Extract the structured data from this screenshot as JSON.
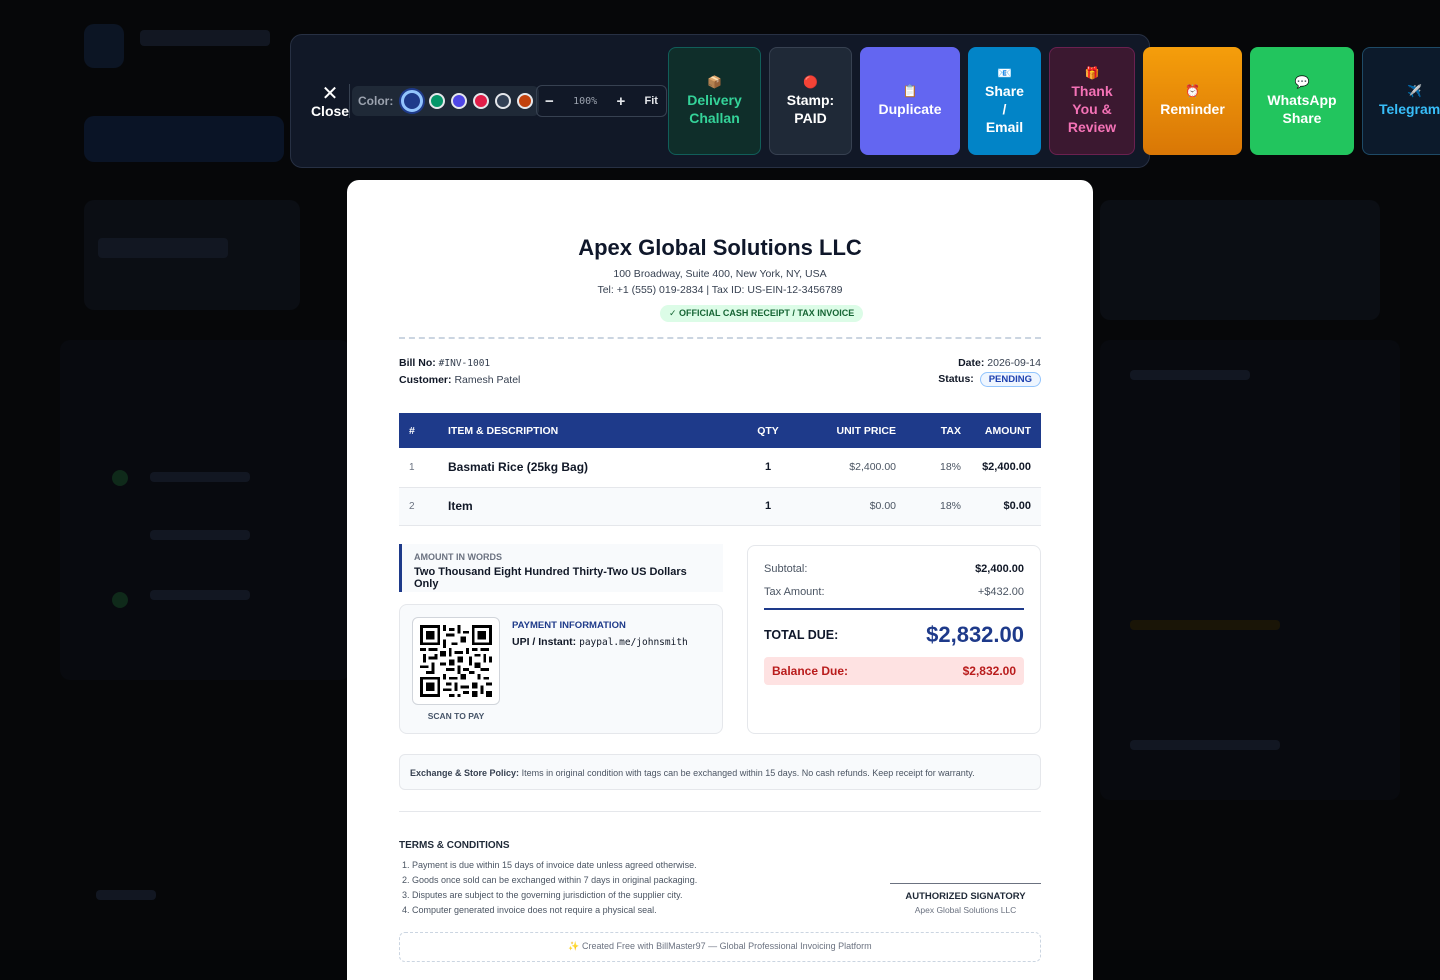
{
  "toolbar": {
    "close_icon": "✕",
    "close_label": "Close",
    "color_label": "Color:",
    "swatches": [
      "#1e3a8a",
      "#059669",
      "#4f46e5",
      "#e11d48",
      "#334155",
      "#c2410c"
    ],
    "zoom_minus": "−",
    "zoom_value": "100%",
    "zoom_plus": "+",
    "fit_label": "Fit",
    "buttons": [
      {
        "icon": "📦",
        "line1": "Delivery",
        "line2": "Challan",
        "line3": ""
      },
      {
        "icon": "🔴",
        "line1": "Stamp:",
        "line2": "PAID",
        "line3": ""
      },
      {
        "icon": "📋",
        "line1": "Duplicate",
        "line2": "",
        "line3": ""
      },
      {
        "icon": "📧",
        "line1": "Share",
        "line2": "/",
        "line3": "Email"
      },
      {
        "icon": "🎁",
        "line1": "Thank",
        "line2": "You &",
        "line3": "Review"
      },
      {
        "icon": "⏰",
        "line1": "Reminder",
        "line2": "",
        "line3": ""
      },
      {
        "icon": "💬",
        "line1": "WhatsApp",
        "line2": "Share",
        "line3": ""
      },
      {
        "icon": "✈️",
        "line1": "Telegram",
        "line2": "",
        "line3": ""
      }
    ]
  },
  "invoice": {
    "company": "Apex Global Solutions LLC",
    "address": "100 Broadway, Suite 400, New York, NY, USA",
    "contact": "Tel: +1 (555) 019-2834 | Tax ID: US-EIN-12-3456789",
    "official_badge": "✓ OFFICIAL CASH RECEIPT / TAX INVOICE",
    "bill_no_label": "Bill No:",
    "bill_no": "#INV-1001",
    "customer_label": "Customer:",
    "customer": "Ramesh Patel",
    "date_label": "Date:",
    "date": "2026-09-14",
    "status_label": "Status:",
    "status": "PENDING",
    "columns": [
      "#",
      "ITEM & DESCRIPTION",
      "QTY",
      "UNIT PRICE",
      "TAX",
      "AMOUNT"
    ],
    "items": [
      {
        "num": "1",
        "desc": "Basmati Rice (25kg Bag)",
        "qty": "1",
        "unit_price": "$2,400.00",
        "tax": "18%",
        "amount": "$2,400.00"
      },
      {
        "num": "2",
        "desc": "Item",
        "qty": "1",
        "unit_price": "$0.00",
        "tax": "18%",
        "amount": "$0.00"
      }
    ],
    "amount_words_label": "AMOUNT IN WORDS",
    "amount_words": "Two Thousand Eight Hundred Thirty-Two US Dollars Only",
    "payment_label": "PAYMENT INFORMATION",
    "payment_method": "UPI / Instant:",
    "payment_handle": "paypal.me/johnsmith",
    "scan_label": "SCAN TO PAY",
    "subtotal_label": "Subtotal:",
    "subtotal": "$2,400.00",
    "tax_label": "Tax Amount:",
    "tax_amount": "+$432.00",
    "total_label": "TOTAL DUE:",
    "total": "$2,832.00",
    "balance_label": "Balance Due:",
    "balance": "$2,832.00",
    "policy_label": "Exchange & Store Policy:",
    "policy_text": "Items in original condition with tags can be exchanged within 15 days. No cash refunds. Keep receipt for warranty.",
    "terms_title": "TERMS & CONDITIONS",
    "terms": [
      "1. Payment is due within 15 days of invoice date unless agreed otherwise.",
      "2. Goods once sold can be exchanged within 7 days in original packaging.",
      "3. Disputes are subject to the governing jurisdiction of the supplier city.",
      "4. Computer generated invoice does not require a physical seal."
    ],
    "signatory_title": "AUTHORIZED SIGNATORY",
    "signatory_name": "Apex Global Solutions LLC",
    "footer": "✨ Created Free with BillMaster97 — Global Professional Invoicing Platform"
  }
}
